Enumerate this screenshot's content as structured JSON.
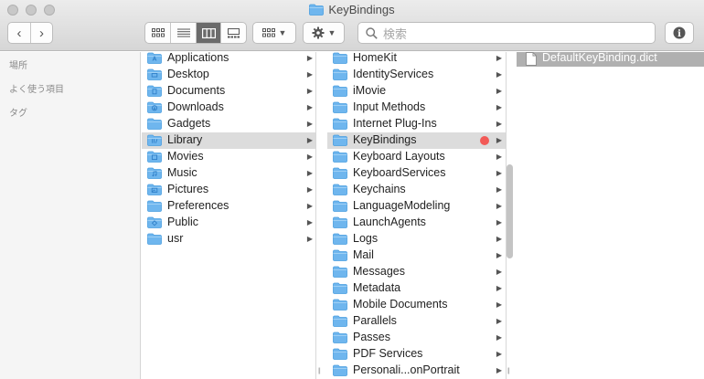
{
  "window": {
    "title": "KeyBindings"
  },
  "toolbar": {
    "back_glyph": "‹",
    "forward_glyph": "›",
    "search_placeholder": "検索",
    "info_glyph": "i"
  },
  "sidebar": {
    "sections": [
      "場所",
      "よく使う項目",
      "タグ"
    ]
  },
  "column1": {
    "items": [
      {
        "label": "Applications",
        "icon": "folder-applications-icon"
      },
      {
        "label": "Desktop",
        "icon": "folder-desktop-icon"
      },
      {
        "label": "Documents",
        "icon": "folder-documents-icon"
      },
      {
        "label": "Downloads",
        "icon": "folder-downloads-icon"
      },
      {
        "label": "Gadgets",
        "icon": "folder-icon"
      },
      {
        "label": "Library",
        "icon": "folder-library-icon",
        "selected": true
      },
      {
        "label": "Movies",
        "icon": "folder-movies-icon"
      },
      {
        "label": "Music",
        "icon": "folder-music-icon"
      },
      {
        "label": "Pictures",
        "icon": "folder-pictures-icon"
      },
      {
        "label": "Preferences",
        "icon": "folder-icon"
      },
      {
        "label": "Public",
        "icon": "folder-public-icon"
      },
      {
        "label": "usr",
        "icon": "folder-icon"
      }
    ]
  },
  "column2": {
    "items": [
      {
        "label": "HomeKit"
      },
      {
        "label": "IdentityServices"
      },
      {
        "label": "iMovie"
      },
      {
        "label": "Input Methods"
      },
      {
        "label": "Internet Plug-Ins"
      },
      {
        "label": "KeyBindings",
        "selected": true,
        "tag_color": "#f25a57"
      },
      {
        "label": "Keyboard Layouts"
      },
      {
        "label": "KeyboardServices"
      },
      {
        "label": "Keychains"
      },
      {
        "label": "LanguageModeling"
      },
      {
        "label": "LaunchAgents"
      },
      {
        "label": "Logs"
      },
      {
        "label": "Mail"
      },
      {
        "label": "Messages"
      },
      {
        "label": "Metadata"
      },
      {
        "label": "Mobile Documents"
      },
      {
        "label": "Parallels"
      },
      {
        "label": "Passes"
      },
      {
        "label": "PDF Services"
      },
      {
        "label": "Personali...onPortrait"
      }
    ]
  },
  "column3": {
    "items": [
      {
        "label": "DefaultKeyBinding.dict",
        "selected": true
      }
    ]
  },
  "colors": {
    "folder": "#6fb6ee",
    "folder_dark": "#4a9ee0",
    "selection": "#dcdcdc",
    "tag_red": "#f25a57"
  }
}
